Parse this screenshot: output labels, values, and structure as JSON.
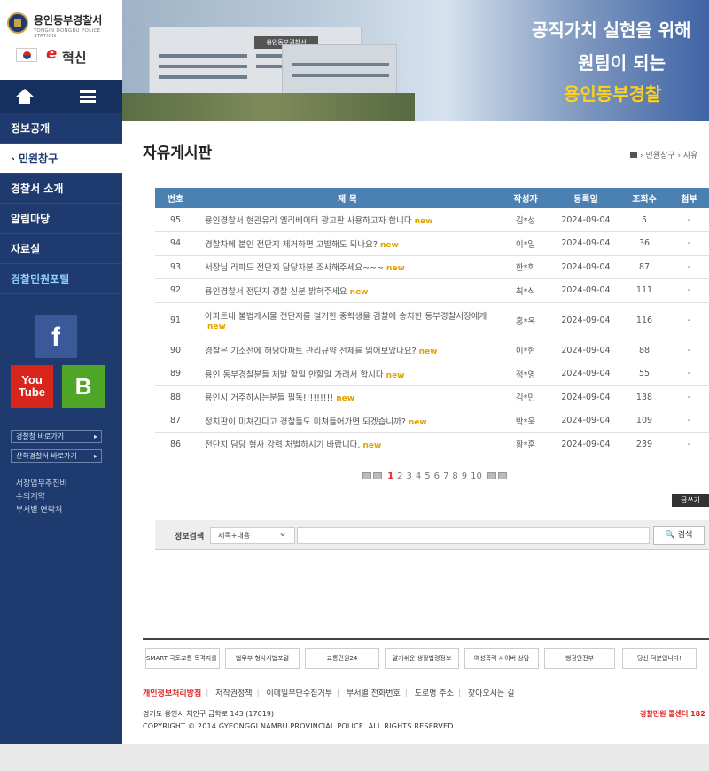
{
  "logo": {
    "name": "용인동부경찰서",
    "eng": "YONGIN DONGBU POLICE STATION",
    "innovation": "혁신",
    "innovation_prefix": "e"
  },
  "nav": {
    "home_icon": "home-icon",
    "menu_icon": "hamburger-icon",
    "items": [
      {
        "label": "정보공개"
      },
      {
        "label": "민원창구"
      },
      {
        "label": "경찰서 소개"
      },
      {
        "label": "알림마당"
      },
      {
        "label": "자료실"
      },
      {
        "label": "경찰민원포털"
      }
    ]
  },
  "sns": {
    "facebook": "f",
    "youtube_1": "You",
    "youtube_2": "Tube",
    "blog": "B"
  },
  "quick_links": [
    "경찰청 바로가기",
    "산하경찰서 바로가기"
  ],
  "side_links": [
    "서장업무추진비",
    "수의계약",
    "부서별 연락처"
  ],
  "banner": {
    "building_sign": "용인동부경찰서",
    "slogan_1": "공직가치 실현을 위해",
    "slogan_2": "원팀이 되는",
    "slogan_3": "용인동부경찰"
  },
  "page": {
    "title": "자유게시판",
    "breadcrumb": "› 민원창구 › 자유"
  },
  "board": {
    "columns": [
      "번호",
      "제 목",
      "작성자",
      "등록일",
      "조회수",
      "첨부"
    ],
    "new_label": "new",
    "rows": [
      {
        "no": "95",
        "title": "용인경찰서 현관유리 엘리베이터 광고판 사용하고자 합니다",
        "author": "김*성",
        "date": "2024-09-04",
        "views": "5",
        "attach": "-"
      },
      {
        "no": "94",
        "title": "경찰차에 붙인 전단지 제거하면 고발해도 되나요?",
        "author": "이*일",
        "date": "2024-09-04",
        "views": "36",
        "attach": "-"
      },
      {
        "no": "93",
        "title": "서장님 라파드 전단지 담당자분 조사해주세요~~~",
        "author": "한*희",
        "date": "2024-09-04",
        "views": "87",
        "attach": "-"
      },
      {
        "no": "92",
        "title": "용인경찰서 전단지 경찰 신분 밝혀주세요",
        "author": "최*식",
        "date": "2024-09-04",
        "views": "111",
        "attach": "-"
      },
      {
        "no": "91",
        "title": "아파트내 불법게시물 전단지를 철거한 중학생을 검찰에 송치한 동부경찰서장에게",
        "author": "홍*옥",
        "date": "2024-09-04",
        "views": "116",
        "attach": "-"
      },
      {
        "no": "90",
        "title": "경찰은 기소전에 해당아파트 관리규약 전체를 읽어보았나요?",
        "author": "이*현",
        "date": "2024-09-04",
        "views": "88",
        "attach": "-"
      },
      {
        "no": "89",
        "title": "용인 동부경찰분들 제발 할일 안할일 가려서 합시다",
        "author": "정*영",
        "date": "2024-09-04",
        "views": "55",
        "attach": "-"
      },
      {
        "no": "88",
        "title": "용인시 거주하시는분들 필독!!!!!!!!!",
        "author": "김*민",
        "date": "2024-09-04",
        "views": "138",
        "attach": "-"
      },
      {
        "no": "87",
        "title": "정치판이 미쳐간다고 경찰들도 미쳐들어가면 되겠습니까?",
        "author": "박*욱",
        "date": "2024-09-04",
        "views": "109",
        "attach": "-"
      },
      {
        "no": "86",
        "title": "전단지 담당 형사 강력 처벌하시기 바랍니다.",
        "author": "황*훈",
        "date": "2024-09-04",
        "views": "239",
        "attach": "-"
      }
    ]
  },
  "pagination": {
    "pages": [
      "1",
      "2",
      "3",
      "4",
      "5",
      "6",
      "7",
      "8",
      "9",
      "10"
    ],
    "current": "1"
  },
  "write_label": "글쓰기",
  "search": {
    "label": "정보검색",
    "select_value": "제목+내용",
    "input_value": "",
    "button_label": "검색"
  },
  "partners": [
    "SMART 국토교통 목격자를 찾습니다!",
    "법무부 형사사법포털",
    "교통민원24",
    "알기쉬운 생활법령정보",
    "여성폭력 사이버 상담",
    "행정안전부",
    "당신 덕분입니다!"
  ],
  "footer": {
    "links": [
      "개인정보처리방침",
      "저작권정책",
      "이메일무단수집거부",
      "부서별 전화번호",
      "도로명 주소",
      "찾아오시는 길"
    ],
    "address": "경기도 용인시 처인구 금학로 143 (17019)",
    "copyright": "COPYRIGHT © 2014 GYEONGGI NAMBU PROVINCIAL POLICE. ALL RIGHTS RESERVED.",
    "callcenter": "경찰민원 콜센터 182"
  }
}
